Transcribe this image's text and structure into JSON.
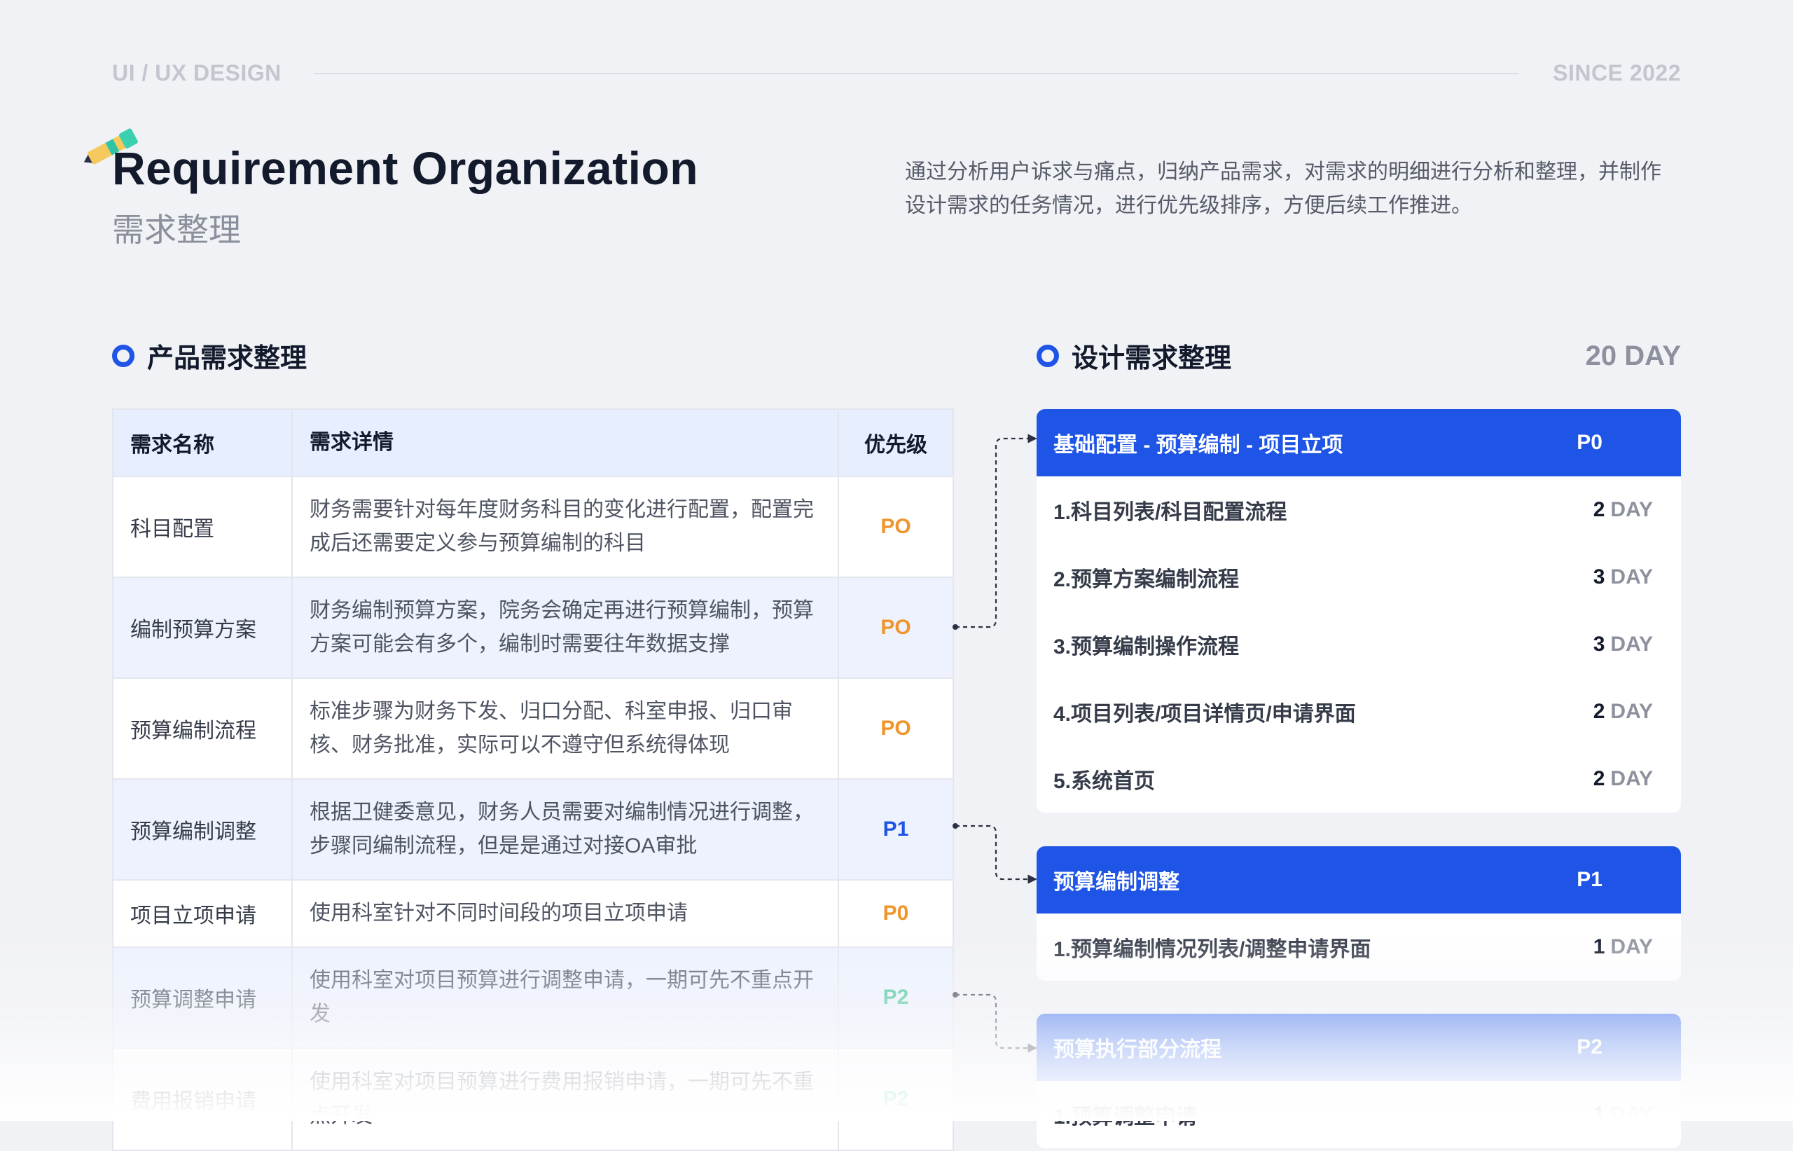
{
  "brand_label": "UI / UX DESIGN",
  "since_label": "SINCE 2022",
  "title_en": "Requirement Organization",
  "title_cn": "需求整理",
  "intro": "通过分析用户诉求与痛点，归纳产品需求，对需求的明细进行分析和整理，并制作设计需求的任务情况，进行优先级排序，方便后续工作推进。",
  "colors": {
    "accent": "#1f55e6",
    "p0": "#f0952c",
    "p1": "#1f55e6",
    "p2": "#33c08a"
  },
  "left_section": {
    "title": "产品需求整理",
    "columns": [
      "需求名称",
      "需求详情",
      "优先级"
    ],
    "rows": [
      {
        "name": "科目配置",
        "detail": "财务需要针对每年度财务科目的变化进行配置，配置完成后还需要定义参与预算编制的科目",
        "priority": "PO"
      },
      {
        "name": "编制预算方案",
        "detail": "财务编制预算方案，院务会确定再进行预算编制，预算方案可能会有多个，编制时需要往年数据支撑",
        "priority": "PO"
      },
      {
        "name": "预算编制流程",
        "detail": "标准步骤为财务下发、归口分配、科室申报、归口审核、财务批准，实际可以不遵守但系统得体现",
        "priority": "PO"
      },
      {
        "name": "预算编制调整",
        "detail": "根据卫健委意见，财务人员需要对编制情况进行调整，步骤同编制流程，但是是通过对接OA审批",
        "priority": "P1"
      },
      {
        "name": "项目立项申请",
        "detail": "使用科室针对不同时间段的项目立项申请",
        "priority": "P0"
      },
      {
        "name": "预算调整申请",
        "detail": "使用科室对项目预算进行调整申请，一期可先不重点开发",
        "priority": "P2"
      },
      {
        "name": "费用报销申请",
        "detail": "使用科室对项目预算进行费用报销申请，一期可先不重点开发",
        "priority": "P2"
      }
    ]
  },
  "right_section": {
    "title": "设计需求整理",
    "total": "20 DAY",
    "day_unit": "DAY",
    "cards": [
      {
        "title": "基础配置 - 预算编制 - 项目立项",
        "priority": "P0",
        "items": [
          {
            "label": "1.科目列表/科目配置流程",
            "days": "2"
          },
          {
            "label": "2.预算方案编制流程",
            "days": "3"
          },
          {
            "label": "3.预算编制操作流程",
            "days": "3"
          },
          {
            "label": "4.项目列表/项目详情页/申请界面",
            "days": "2"
          },
          {
            "label": "5.系统首页",
            "days": "2"
          }
        ]
      },
      {
        "title": "预算编制调整",
        "priority": "P1",
        "items": [
          {
            "label": "1.预算编制情况列表/调整申请界面",
            "days": "1"
          }
        ]
      },
      {
        "title": "预算执行部分流程",
        "priority": "P2",
        "items": [
          {
            "label": "1.预算调整申请",
            "days": "1"
          }
        ]
      }
    ]
  }
}
